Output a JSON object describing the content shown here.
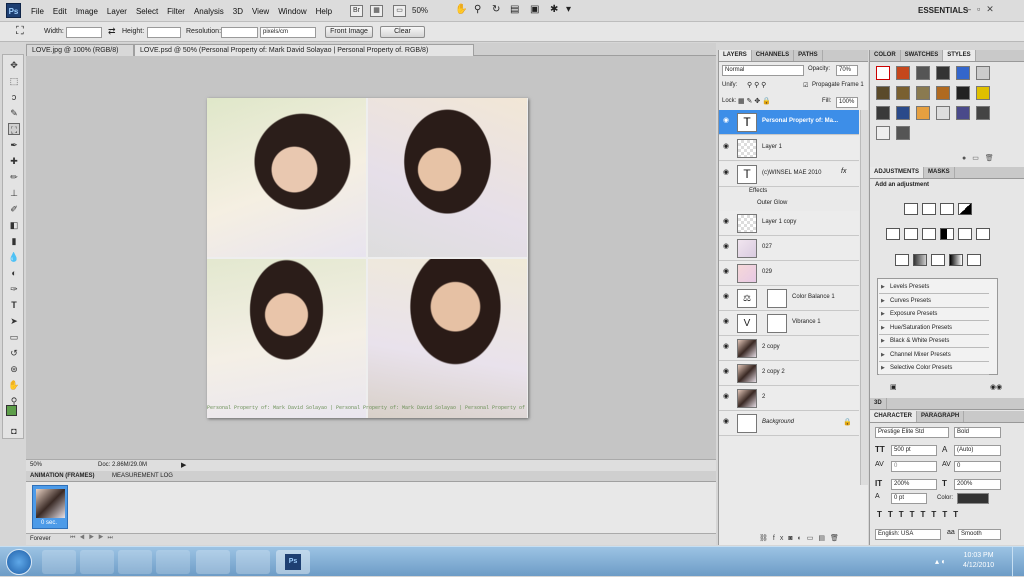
{
  "app": {
    "logo": "Ps",
    "menus": [
      "File",
      "Edit",
      "Image",
      "Layer",
      "Select",
      "Filter",
      "Analysis",
      "3D",
      "View",
      "Window",
      "Help"
    ],
    "zoom": "50%",
    "workspace": "ESSENTIALS"
  },
  "options": {
    "width_label": "Width:",
    "height_label": "Height:",
    "resolution_label": "Resolution:",
    "units": "pixels/cm",
    "front_image": "Front Image",
    "clear": "Clear"
  },
  "tabs": [
    {
      "label": "LOVE.jpg @ 100% (RGB/8)"
    },
    {
      "label": "LOVE.psd @ 50% (Personal Property of: Mark David Solayao | Personal Property of. RGB/8)"
    }
  ],
  "canvas": {
    "watermark": "Personal Property of: Mark David Solayao | Personal Property of: Mark David Solayao | Personal Property of"
  },
  "status": {
    "zoom": "50%",
    "doc": "Doc: 2.86M/29.0M"
  },
  "animation": {
    "tabs": [
      "ANIMATION (FRAMES)",
      "MEASUREMENT LOG"
    ],
    "frame_time": "0 sec.",
    "loop": "Forever"
  },
  "layers_panel": {
    "tabs": [
      "LAYERS",
      "CHANNELS",
      "PATHS"
    ],
    "blend": "Normal",
    "opacity_label": "Opacity:",
    "opacity": "70%",
    "unify": "Unify:",
    "propagate": "Propagate Frame 1",
    "lock": "Lock:",
    "fill_label": "Fill:",
    "fill": "100%",
    "layers": [
      {
        "name": "Personal Property of: Ma...",
        "selected": true
      },
      {
        "name": "Layer 1"
      },
      {
        "name": "(c)WINSEL MAE 2010"
      },
      {
        "name": "Effects"
      },
      {
        "name": "Outer Glow"
      },
      {
        "name": "Layer 1 copy"
      },
      {
        "name": "027"
      },
      {
        "name": "029"
      },
      {
        "name": "Color Balance 1"
      },
      {
        "name": "Vibrance 1"
      },
      {
        "name": "2 copy"
      },
      {
        "name": "2 copy 2"
      },
      {
        "name": "2"
      },
      {
        "name": "Background"
      }
    ]
  },
  "right": {
    "color_tabs": [
      "COLOR",
      "SWATCHES",
      "STYLES"
    ],
    "adj_tabs": [
      "ADJUSTMENTS",
      "MASKS"
    ],
    "add_adjustment": "Add an adjustment",
    "presets": [
      "Levels Presets",
      "Curves Presets",
      "Exposure Presets",
      "Hue/Saturation Presets",
      "Black & White Presets",
      "Channel Mixer Presets",
      "Selective Color Presets"
    ],
    "threed": "3D",
    "char_tabs": [
      "CHARACTER",
      "PARAGRAPH"
    ],
    "font": "Prestige Elite Std",
    "style": "Bold",
    "size": "500 pt",
    "leading": "(Auto)",
    "kerning": "0",
    "tracking": "0",
    "vscale": "200%",
    "hscale": "200%",
    "baseline": "0 pt",
    "color_label": "Color:",
    "language": "English: USA",
    "aa": "Smooth"
  },
  "taskbar": {
    "time": "10:03 PM",
    "date": "4/12/2010"
  },
  "colors": {
    "selected_layer": "#3d8ee8",
    "ps_blue": "#1e3f72"
  }
}
